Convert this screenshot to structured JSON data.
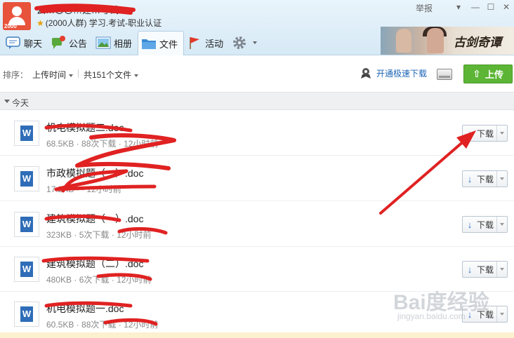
{
  "header": {
    "group_name": "云…〇〇…建…考试",
    "group_sub": "(2000人群) 学习.考试-职业认证",
    "avatar_level": "2000",
    "report": "举报",
    "tabs": [
      {
        "label": "聊天",
        "icon": "chat-icon"
      },
      {
        "label": "公告",
        "icon": "announcement-icon"
      },
      {
        "label": "相册",
        "icon": "album-icon"
      },
      {
        "label": "文件",
        "icon": "folder-icon",
        "active": true
      },
      {
        "label": "活动",
        "icon": "flag-icon"
      },
      {
        "label": "",
        "icon": "gear-icon"
      }
    ],
    "banner_title": "古剑奇谭"
  },
  "toolbar": {
    "sort_label": "排序：",
    "sort_value": "上传时间",
    "count": "共151个文件",
    "speed_download": "开通极速下载",
    "upload": "上传"
  },
  "section": {
    "label": "今天"
  },
  "files": [
    {
      "name": "机电模拟题二.doc",
      "size": "68.5KB",
      "downloads": "88次下载",
      "time": "12小时前",
      "download_label": "下载"
    },
    {
      "name": "市政模拟题（一）.doc",
      "size": "17.2KB",
      "downloads": "",
      "time": "12小时前",
      "download_label": "下载"
    },
    {
      "name": "建筑模拟题（一）.doc",
      "size": "323KB",
      "downloads": "5次下载",
      "time": "12小时前",
      "download_label": "下载"
    },
    {
      "name": "建筑模拟题（二）.doc",
      "size": "480KB",
      "downloads": "6次下载",
      "time": "12小时前",
      "download_label": "下载"
    },
    {
      "name": "机电模拟题一.doc",
      "size": "60.5KB",
      "downloads": "88次下载",
      "time": "12小时前",
      "download_label": "下载"
    }
  ],
  "watermark": {
    "text": "Bai度经验",
    "sub": "jingyan.baidu.com"
  },
  "colors": {
    "accent": "#5cb535",
    "link": "#1c64b4",
    "scribble": "#e02222",
    "doc_icon": "#2f6db8"
  }
}
